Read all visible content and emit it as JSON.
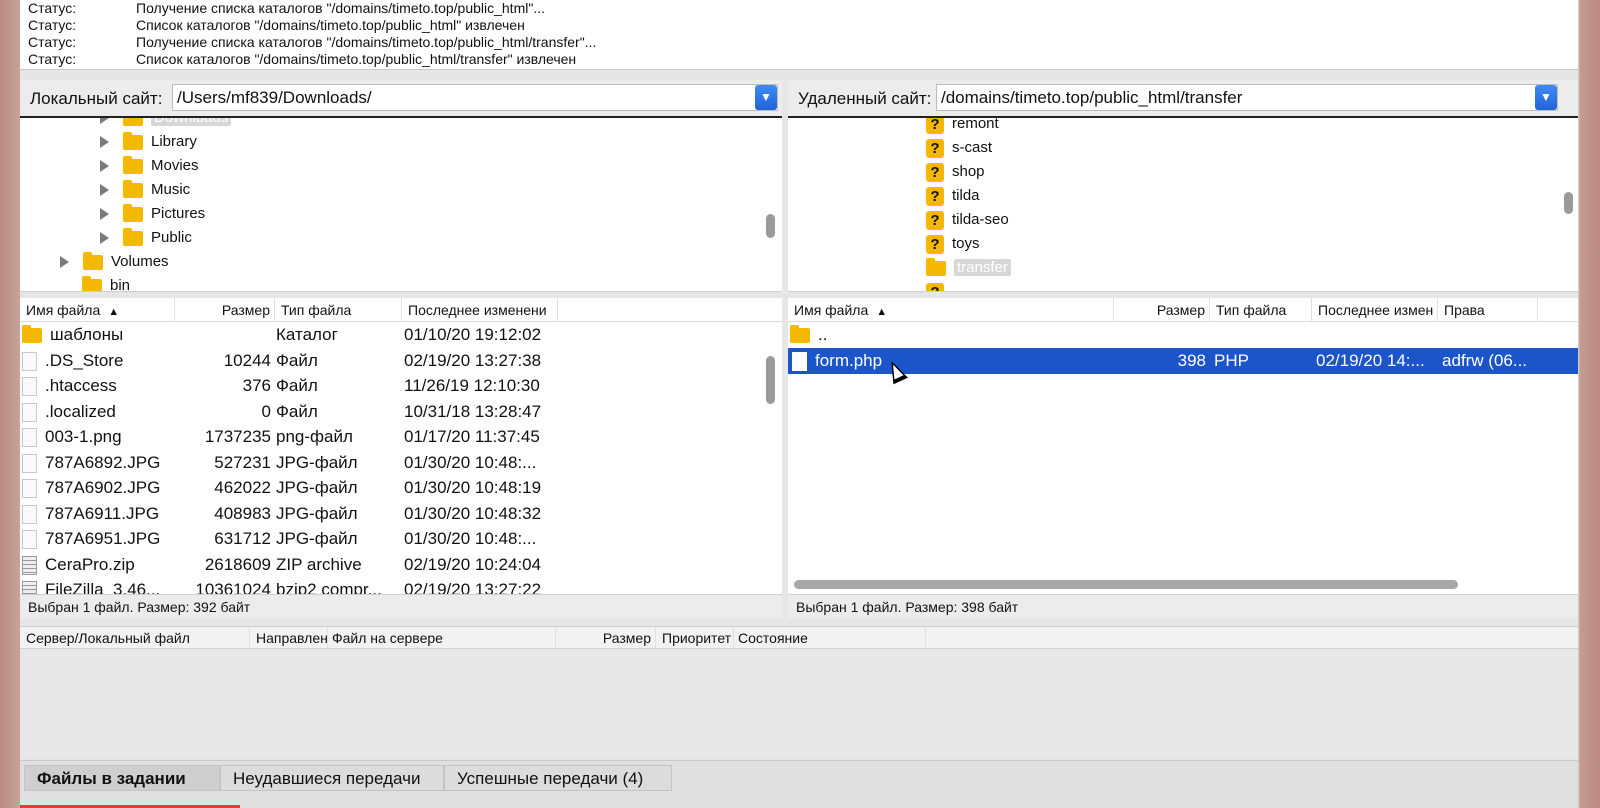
{
  "log": [
    {
      "label": "Статус:",
      "msg": "Получение списка каталогов \"/domains/timeto.top/public_html\"..."
    },
    {
      "label": "Статус:",
      "msg": "Список каталогов \"/domains/timeto.top/public_html\" извлечен"
    },
    {
      "label": "Статус:",
      "msg": "Получение списка каталогов \"/domains/timeto.top/public_html/transfer\"..."
    },
    {
      "label": "Статус:",
      "msg": "Список каталогов \"/domains/timeto.top/public_html/transfer\" извлечен"
    }
  ],
  "local": {
    "label": "Локальный сайт:",
    "path": "/Users/mf839/Downloads/",
    "tree": [
      "Downloads",
      "Library",
      "Movies",
      "Music",
      "Pictures",
      "Public",
      "Volumes",
      "bin"
    ],
    "columns": [
      "Имя файла",
      "Размер",
      "Тип файла",
      "Последнее изменени"
    ],
    "files": [
      {
        "name": "шаблоны",
        "size": "",
        "type": "Каталог",
        "modified": "01/10/20 19:12:02"
      },
      {
        "name": ".DS_Store",
        "size": "10244",
        "type": "Файл",
        "modified": "02/19/20 13:27:38"
      },
      {
        "name": ".htaccess",
        "size": "376",
        "type": "Файл",
        "modified": "11/26/19 12:10:30"
      },
      {
        "name": ".localized",
        "size": "0",
        "type": "Файл",
        "modified": "10/31/18 13:28:47"
      },
      {
        "name": "003-1.png",
        "size": "1737235",
        "type": "png-файл",
        "modified": "01/17/20 11:37:45"
      },
      {
        "name": "787A6892.JPG",
        "size": "527231",
        "type": "JPG-файл",
        "modified": "01/30/20 10:48:..."
      },
      {
        "name": "787A6902.JPG",
        "size": "462022",
        "type": "JPG-файл",
        "modified": "01/30/20 10:48:19"
      },
      {
        "name": "787A6911.JPG",
        "size": "408983",
        "type": "JPG-файл",
        "modified": "01/30/20 10:48:32"
      },
      {
        "name": "787A6951.JPG",
        "size": "631712",
        "type": "JPG-файл",
        "modified": "01/30/20 10:48:..."
      },
      {
        "name": "CeraPro.zip",
        "size": "2618609",
        "type": "ZIP archive",
        "modified": "02/19/20 10:24:04"
      },
      {
        "name": "FileZilla_3.46...",
        "size": "10361024",
        "type": "bzip2 compr...",
        "modified": "02/19/20 13:27:22"
      }
    ],
    "status": "Выбран 1 файл. Размер: 392 байт"
  },
  "remote": {
    "label": "Удаленный сайт:",
    "path": "/domains/timeto.top/public_html/transfer",
    "tree": [
      "remont",
      "s-cast",
      "shop",
      "tilda",
      "tilda-seo",
      "toys",
      "transfer"
    ],
    "columns": [
      "Имя файла",
      "Размер",
      "Тип файла",
      "Последнее измен",
      "Права"
    ],
    "parent": "..",
    "files": [
      {
        "name": "form.php",
        "size": "398",
        "type": "PHP",
        "modified": "02/19/20 14:...",
        "perms": "adfrw (06..."
      }
    ],
    "status": "Выбран 1 файл. Размер: 398 байт"
  },
  "queue": {
    "columns": [
      "Сервер/Локальный файл",
      "Направлен",
      "Файл на сервере",
      "Размер",
      "Приоритет",
      "Состояние"
    ]
  },
  "tabs": [
    "Файлы в задании",
    "Неудавшиеся передачи",
    "Успешные передачи (4)"
  ]
}
